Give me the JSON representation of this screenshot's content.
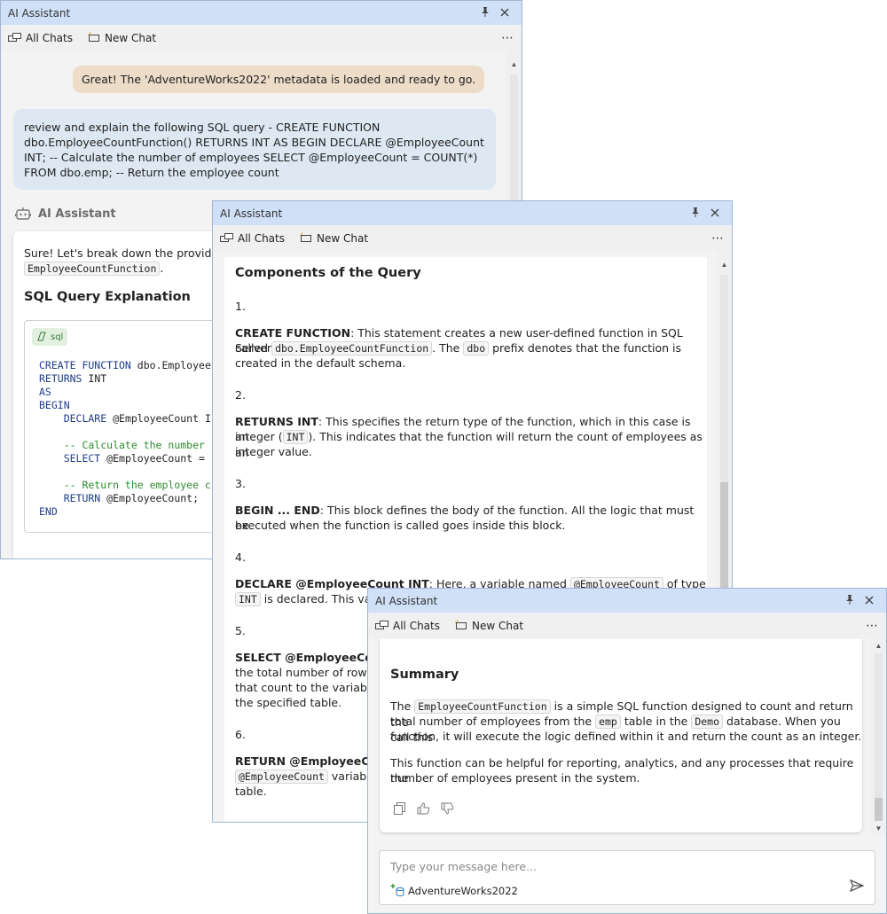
{
  "window_title": "AI Assistant",
  "toolbar": {
    "all_chats": "All Chats",
    "new_chat": "New Chat",
    "more": "⋯"
  },
  "title_buttons": {
    "pin": "📌",
    "close": "✕"
  },
  "win1": {
    "assistant_message": "Great! The 'AdventureWorks2022' metadata is loaded and ready to go.",
    "user_message": "review and explain the following SQL query - CREATE FUNCTION dbo.EmployeeCountFunction() RETURNS INT AS BEGIN DECLARE @EmployeeCount INT; -- Calculate the number of employees SELECT @EmployeeCount = COUNT(*) FROM dbo.emp; -- Return the employee count",
    "ai_header": "AI Assistant",
    "response_intro": "Sure! Let's break down the provided",
    "response_intro_code": "EmployeeCountFunction",
    "response_intro_end": ".",
    "section_title": "SQL Query Explanation",
    "code_lang": "sql",
    "code_lines": [
      {
        "kw": "CREATE FUNCTION",
        "rest": " dbo.Employee"
      },
      {
        "kw": "RETURNS",
        "rest": " INT"
      },
      {
        "kw": "AS",
        "rest": ""
      },
      {
        "kw": "BEGIN",
        "rest": ""
      },
      {
        "kw": "    DECLARE",
        "rest": " @EmployeeCount I"
      },
      {
        "kw": "",
        "rest": ""
      },
      {
        "cm": "    -- Calculate the number"
      },
      {
        "kw": "    SELECT",
        "rest": " @EmployeeCount ="
      },
      {
        "kw": "",
        "rest": ""
      },
      {
        "cm": "    -- Return the employee c"
      },
      {
        "kw": "    RETURN",
        "rest": " @EmployeeCount;"
      },
      {
        "kw": "END",
        "rest": ""
      }
    ]
  },
  "win2": {
    "section_title": "Components of the Query",
    "items": [
      {
        "num": "1.",
        "bold": "CREATE FUNCTION",
        "text1": ": This statement creates a new user-defined function in SQL Server",
        "text2a": "called ",
        "code1": "dbo.EmployeeCountFunction",
        "text2b": ". The ",
        "code2": "dbo",
        "text2c": " prefix denotes that the function is",
        "text3": "created in the default schema."
      },
      {
        "num": "2.",
        "bold": "RETURNS INT",
        "text1": ": This specifies the return type of the function, which in this case is an",
        "text2a": "integer (",
        "code1": "INT",
        "text2b": "). This indicates that the function will return the count of employees as an",
        "text3": "integer value."
      },
      {
        "num": "3.",
        "bold": "BEGIN ... END",
        "text1": ": This block defines the body of the function. All the logic that must be",
        "text2": "executed when the function is called goes inside this block."
      },
      {
        "num": "4.",
        "bold": "DECLARE @EmployeeCount INT",
        "text1a": ": Here, a variable named ",
        "code1": "@EmployeeCount",
        "text1b": " of type",
        "code2": "INT",
        "text2": " is declared. This vari"
      },
      {
        "num": "5.",
        "bold": "SELECT @EmployeeCoun",
        "line2": "the total number of rows",
        "line3": "that count to the variable",
        "line4": "the specified table."
      },
      {
        "num": "6.",
        "bold": "RETURN @EmployeeCou",
        "code1": "@EmployeeCount",
        "line2": " variable",
        "line3": "table."
      }
    ]
  },
  "win3": {
    "section_title": "Summary",
    "p1_a": "The ",
    "p1_code1": "EmployeeCountFunction",
    "p1_b": " is a simple SQL function designed to count and return the",
    "p1_c": "total number of employees from the ",
    "p1_code2": "emp",
    "p1_d": " table in the ",
    "p1_code3": "Demo",
    "p1_e": " database. When you call this",
    "p1_f": "function, it will execute the logic defined within it and return the count as an integer.",
    "p2_a": "This function can be helpful for reporting, analytics, and any processes that require the",
    "p2_b": "number of employees present in the system.",
    "input_placeholder": "Type your message here...",
    "context_db": "AdventureWorks2022"
  }
}
